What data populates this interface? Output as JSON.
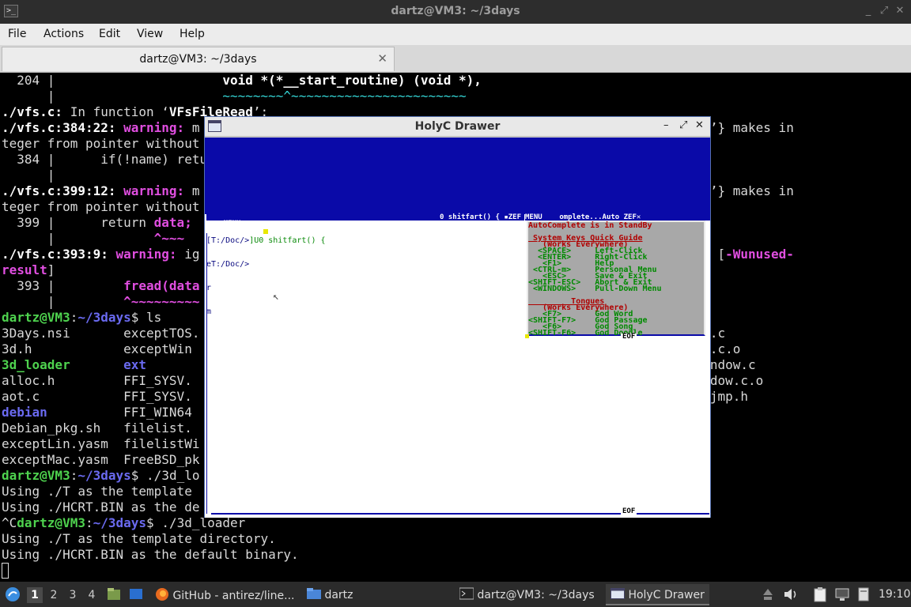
{
  "window": {
    "title": "dartz@VM3: ~/3days",
    "controls": [
      "_",
      "⤢",
      "✕"
    ]
  },
  "menu": {
    "items": [
      "File",
      "Actions",
      "Edit",
      "View",
      "Help"
    ]
  },
  "tabs": [
    {
      "label": "dartz@VM3: ~/3days",
      "close": "✕"
    }
  ],
  "terminal": {
    "lines": [
      {
        "segs": [
          {
            "t": "  204 |                      ",
            "c": ""
          },
          {
            "t": "void *(*__start_routine) (void *),",
            "c": "cy bo"
          }
        ]
      },
      {
        "segs": [
          {
            "t": "      |                      ",
            "c": ""
          },
          {
            "t": "~~~~~~~~^~~~~~~~~~~~~~~~~~~~~~~~",
            "c": "cy"
          }
        ]
      },
      {
        "segs": [
          {
            "t": "./vfs.c:",
            "c": "bo"
          },
          {
            "t": " In function ‘",
            "c": ""
          },
          {
            "t": "VFsFileRead",
            "c": "bo"
          },
          {
            "t": "’:",
            "c": ""
          }
        ]
      },
      {
        "segs": [
          {
            "t": "./vfs.c:384:22: ",
            "c": "bo"
          },
          {
            "t": "warning: ",
            "c": "mag"
          },
          {
            "t": "m                                                        a ‘",
            "c": ""
          },
          {
            "t": "long int",
            "c": "bo"
          },
          {
            "t": "’} makes in",
            "c": ""
          }
        ]
      },
      {
        "segs": [
          {
            "t": "teger from pointer without",
            "c": ""
          }
        ]
      },
      {
        "segs": [
          {
            "t": "  384 |      if(!name) retu",
            "c": ""
          }
        ]
      },
      {
        "segs": [
          {
            "t": "      |",
            "c": ""
          }
        ]
      },
      {
        "segs": [
          {
            "t": "./vfs.c:399:12: ",
            "c": "bo"
          },
          {
            "t": "warning: ",
            "c": "mag"
          },
          {
            "t": "m                                                        a ‘",
            "c": ""
          },
          {
            "t": "long int",
            "c": "bo"
          },
          {
            "t": "’} makes in",
            "c": ""
          }
        ]
      },
      {
        "segs": [
          {
            "t": "teger from pointer without",
            "c": ""
          }
        ]
      },
      {
        "segs": [
          {
            "t": "  399 |      return ",
            "c": ""
          },
          {
            "t": "data;",
            "c": "mag"
          }
        ]
      },
      {
        "segs": [
          {
            "t": "      |             ",
            "c": ""
          },
          {
            "t": "^~~~",
            "c": "mag"
          }
        ]
      },
      {
        "segs": [
          {
            "t": "./vfs.c:393:9: ",
            "c": "bo"
          },
          {
            "t": "warning: ",
            "c": "mag"
          },
          {
            "t": "ig                                                        ",
            "c": ""
          },
          {
            "t": "sed_result",
            "c": "bo"
          },
          {
            "t": "’ [",
            "c": ""
          },
          {
            "t": "-Wunused-",
            "c": "mag"
          }
        ]
      },
      {
        "segs": [
          {
            "t": "result",
            "c": "mag"
          },
          {
            "t": "]",
            "c": ""
          }
        ]
      },
      {
        "segs": [
          {
            "t": "  393 |         ",
            "c": ""
          },
          {
            "t": "fread(data",
            "c": "mag"
          }
        ]
      },
      {
        "segs": [
          {
            "t": "      |         ",
            "c": ""
          },
          {
            "t": "^~~~~~~~~~",
            "c": "mag"
          }
        ]
      },
      {
        "segs": [
          {
            "t": "dartz@VM3",
            "c": "prompt"
          },
          {
            "t": ":",
            "c": ""
          },
          {
            "t": "~/3days",
            "c": "path"
          },
          {
            "t": "$ ls",
            "c": ""
          }
        ]
      },
      {
        "segs": [
          {
            "t": "3Days.nsi       exceptTOS.                                                        yasm.o  vfs.c",
            "c": ""
          }
        ]
      },
      {
        "segs": [
          {
            "t": "3d.h            exceptWin                                                         asm     vfs.c.o",
            "c": ""
          }
        ]
      },
      {
        "segs": [
          {
            "t": "3d_loader",
            "c": "gr"
          },
          {
            "t": "       ",
            "c": ""
          },
          {
            "t": "ext",
            "c": "bl"
          },
          {
            "t": "                                                                        window.c",
            "c": ""
          }
        ]
      },
      {
        "segs": [
          {
            "t": "alloc.h         FFI_SYSV.                                                                 window.c.o",
            "c": ""
          }
        ]
      },
      {
        "segs": [
          {
            "t": "aot.c           FFI_SYSV.                                                                 winjmp.h",
            "c": ""
          }
        ]
      },
      {
        "segs": [
          {
            "t": "debian",
            "c": "bl"
          },
          {
            "t": "          FFI_WIN64",
            "c": ""
          }
        ]
      },
      {
        "segs": [
          {
            "t": "Debian_pkg.sh   filelist.",
            "c": ""
          }
        ]
      },
      {
        "segs": [
          {
            "t": "exceptLin.yasm  filelistWi",
            "c": ""
          }
        ]
      },
      {
        "segs": [
          {
            "t": "exceptMac.yasm  FreeBSD_pk",
            "c": ""
          }
        ]
      },
      {
        "segs": [
          {
            "t": "dartz@VM3",
            "c": "prompt"
          },
          {
            "t": ":",
            "c": ""
          },
          {
            "t": "~/3days",
            "c": "path"
          },
          {
            "t": "$ ./3d_lo",
            "c": ""
          }
        ]
      },
      {
        "segs": [
          {
            "t": "Using ./T as the template",
            "c": ""
          }
        ]
      },
      {
        "segs": [
          {
            "t": "Using ./HCRT.BIN as the de",
            "c": ""
          }
        ]
      },
      {
        "segs": [
          {
            "t": "^C",
            "c": ""
          },
          {
            "t": "dartz@VM3",
            "c": "prompt"
          },
          {
            "t": ":",
            "c": ""
          },
          {
            "t": "~/3days",
            "c": "path"
          },
          {
            "t": "$ ./3d_loader",
            "c": ""
          }
        ]
      },
      {
        "segs": [
          {
            "t": "Using ./T as the template directory.",
            "c": ""
          }
        ]
      },
      {
        "segs": [
          {
            "t": "Using ./HCRT.BIN as the default binary.",
            "c": ""
          }
        ]
      }
    ]
  },
  "holyc": {
    "title": "HolyC Drawer",
    "controls": [
      "–",
      "⤢",
      "✕"
    ],
    "doc_bar_left": "MENU",
    "doc_bar_right": "0 shitfart() { ▪ZEF",
    "doc_line1_a": "[T:/Doc/>",
    "doc_line1_b": "]U0 shitfart() {",
    "doc_line2": "eT:/Doc/>",
    "doc_line3": "r",
    "doc_line4": "m",
    "eof": "EOF",
    "ac_bar": "MENU    omplete...Auto ZEF✕",
    "autocomplete": [
      {
        "text": "AutoComplete is in StandBy",
        "c": "ac-r",
        "ul": false
      },
      {
        "text": "",
        "c": "",
        "ul": false
      },
      {
        "text": " System Keys Quick Guide",
        "c": "ac-r",
        "ul": true
      },
      {
        "text": "   (Works Everywhere)",
        "c": "ac-r",
        "ul": false
      },
      {
        "text": "  <SPACE>     Left-Click",
        "c": "ac-g",
        "ul": false
      },
      {
        "text": "  <ENTER>     Right-Click",
        "c": "ac-g",
        "ul": false
      },
      {
        "text": "   <F1>       Help",
        "c": "ac-g",
        "ul": false
      },
      {
        "text": " <CTRL-m>     Personal Menu",
        "c": "ac-g",
        "ul": false
      },
      {
        "text": "   <ESC>      Save & Exit",
        "c": "ac-g",
        "ul": false
      },
      {
        "text": "<SHIFT-ESC>   Abort & Exit",
        "c": "ac-g",
        "ul": false
      },
      {
        "text": " <WINDOWS>    Pull-Down Menu",
        "c": "ac-g",
        "ul": false
      },
      {
        "text": "",
        "c": "",
        "ul": false
      },
      {
        "text": "         Tongues",
        "c": "ac-r",
        "ul": true
      },
      {
        "text": "   (Works Everywhere)",
        "c": "ac-r",
        "ul": false
      },
      {
        "text": "   <F7>       God Word",
        "c": "ac-g",
        "ul": false
      },
      {
        "text": "<SHIFT-F7>    God Passage",
        "c": "ac-g",
        "ul": false
      },
      {
        "text": "   <F6>       God Song",
        "c": "ac-g",
        "ul": false
      },
      {
        "text": "<SHIFT-F6>    God Doodle",
        "c": "ac-g",
        "ul": false
      }
    ]
  },
  "taskbar": {
    "workspaces": [
      "1",
      "2",
      "3",
      "4"
    ],
    "tasks": [
      {
        "label": "GitHub - antirez/line...",
        "icon": "firefox-icon"
      },
      {
        "label": "dartz",
        "icon": "folder-icon"
      },
      {
        "label": "dartz@VM3: ~/3days",
        "icon": "terminal-icon"
      },
      {
        "label": "HolyC Drawer",
        "icon": "window-icon"
      }
    ],
    "clock": "19:10"
  }
}
